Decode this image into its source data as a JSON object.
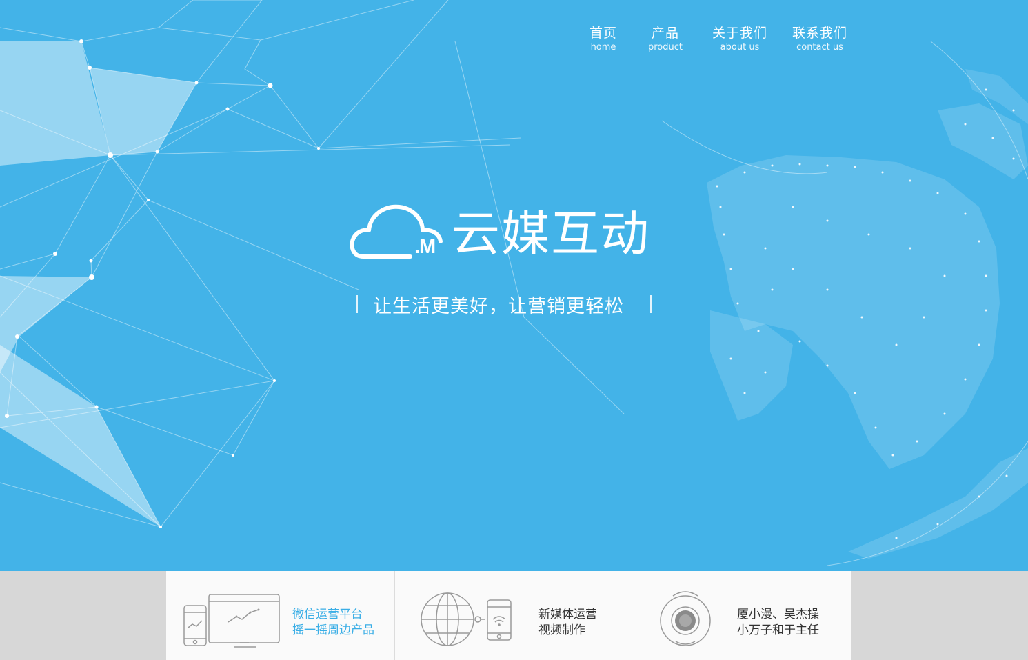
{
  "nav": {
    "items": [
      {
        "zh": "首页",
        "en": "home"
      },
      {
        "zh": "产品",
        "en": "product"
      },
      {
        "zh": "关于我们",
        "en": "about us"
      },
      {
        "zh": "联系我们",
        "en": "contact us"
      }
    ]
  },
  "hero": {
    "logo_mark": ".M",
    "logo_text": "云媒互动",
    "slogan": "让生活更美好，让营销更轻松"
  },
  "features": [
    {
      "line1": "微信运营平台",
      "line2": "摇一摇周边产品",
      "icon": "devices-chart-icon"
    },
    {
      "line1": "新媒体运营",
      "line2": "视频制作",
      "icon": "globe-phone-icon"
    },
    {
      "line1": "厦小漫、吴杰操",
      "line2": "小万子和于主任",
      "icon": "mascot-robot-icon"
    }
  ],
  "colors": {
    "hero_bg": "#43b3e8",
    "accent_text": "#3aaee6",
    "card_bg": "#fafafa",
    "page_bg": "#d7d7d7"
  }
}
